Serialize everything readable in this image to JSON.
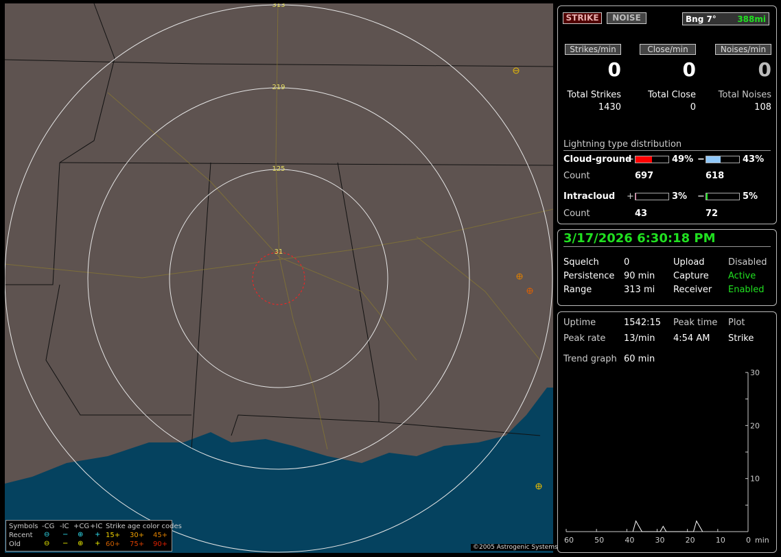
{
  "map": {
    "range_rings": [
      "313",
      "219",
      "125",
      "31"
    ],
    "legend": {
      "header": [
        "Symbols",
        "-CG",
        "-IC",
        "+CG",
        "+IC"
      ],
      "age_title": "Strike age color codes",
      "recent_label": "Recent",
      "old_label": "Old",
      "recent_symbols": [
        "⊖",
        "−",
        "⊕",
        "+"
      ],
      "old_symbols": [
        "⊖",
        "−",
        "⊕",
        "+"
      ],
      "recent_ages": [
        "15+",
        "30+",
        "45+"
      ],
      "old_ages": [
        "60+",
        "75+",
        "90+"
      ],
      "recent_color": "#30e0f0",
      "old_color": "#f0f000",
      "age_colors": [
        "#f0d000",
        "#f0a000",
        "#e08000",
        "#d06000",
        "#e04000",
        "#e02000"
      ]
    },
    "copyright": "©2005 Astrogenic Systems"
  },
  "status": {
    "strike_label": "STRIKE",
    "noise_label": "NOISE",
    "bearing": "Bng 7°",
    "distance": "388mi",
    "rates": [
      {
        "label": "Strikes/min",
        "value": "0"
      },
      {
        "label": "Close/min",
        "value": "0"
      },
      {
        "label": "Noises/min",
        "value": "0"
      }
    ],
    "totals": [
      {
        "label": "Total Strikes",
        "value": "1430"
      },
      {
        "label": "Total Close",
        "value": "0"
      },
      {
        "label": "Total Noises",
        "value": "108"
      }
    ]
  },
  "distribution": {
    "title": "Lightning type distribution",
    "cg_label": "Cloud-ground",
    "ic_label": "Intracloud",
    "count_label": "Count",
    "plus": "+",
    "minus": "−",
    "cg_plus": {
      "pct": "49%",
      "value": 49,
      "count": "697",
      "color": "#ff0000"
    },
    "cg_minus": {
      "pct": "43%",
      "value": 43,
      "count": "618",
      "color": "#90c8f8"
    },
    "ic_plus": {
      "pct": "3%",
      "value": 3,
      "count": "43",
      "color": "#e070a0"
    },
    "ic_minus": {
      "pct": "5%",
      "value": 5,
      "count": "72",
      "color": "#20e020"
    }
  },
  "info": {
    "datetime": "3/17/2026 6:30:18 PM",
    "rows": [
      {
        "k1": "Squelch",
        "v1": "0",
        "k2": "Upload",
        "v2": "Disabled"
      },
      {
        "k1": "Persistence",
        "v1": "90 min",
        "k2": "Capture",
        "v2": "Active"
      },
      {
        "k1": "Range",
        "v1": "313 mi",
        "k2": "Receiver",
        "v2": "Enabled"
      }
    ]
  },
  "stats": {
    "uptime_label": "Uptime",
    "uptime": "1542:15",
    "peak_time_label": "Peak time",
    "plot_label": "Plot",
    "peak_rate_label": "Peak rate",
    "peak_rate": "13/min",
    "peak_time": "4:54 AM",
    "plot": "Strike",
    "trend_label": "Trend graph",
    "trend": "60 min"
  },
  "chart_data": {
    "type": "line",
    "x_ticks": [
      "60",
      "50",
      "40",
      "30",
      "20",
      "10",
      "0"
    ],
    "x_unit": "min",
    "y_ticks": [
      "30",
      "20",
      "10"
    ],
    "xlim": [
      60,
      0
    ],
    "ylim": [
      0,
      30
    ],
    "series": [
      {
        "x": [
          38,
          37,
          36,
          35,
          29,
          28,
          27,
          18,
          17,
          16,
          15
        ],
        "y": [
          0,
          2,
          1,
          0,
          0,
          1,
          0,
          0,
          2,
          1,
          0
        ]
      }
    ]
  }
}
